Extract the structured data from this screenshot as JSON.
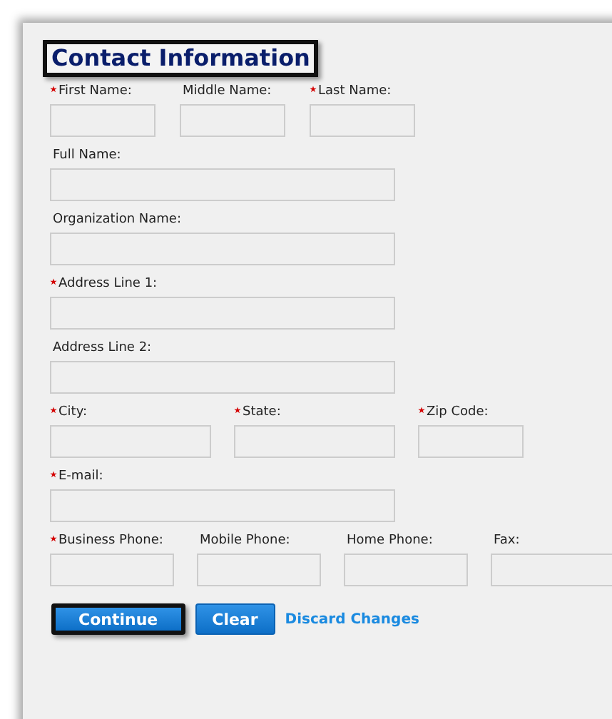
{
  "title": "Contact Information",
  "rows": [
    {
      "fields": [
        {
          "label": "First Name:",
          "required": true
        },
        {
          "label": "Middle Name:",
          "required": false
        },
        {
          "label": "Last Name:",
          "required": true
        }
      ]
    },
    {
      "fields": [
        {
          "label": "Full Name:",
          "required": false
        }
      ]
    },
    {
      "fields": [
        {
          "label": "Organization Name:",
          "required": false
        }
      ]
    },
    {
      "fields": [
        {
          "label": "Address Line 1:",
          "required": true
        }
      ]
    },
    {
      "fields": [
        {
          "label": "Address Line 2:",
          "required": false
        }
      ]
    },
    {
      "fields": [
        {
          "label": "City:",
          "required": true
        },
        {
          "label": "State:",
          "required": true
        },
        {
          "label": "Zip Code:",
          "required": true
        }
      ]
    },
    {
      "fields": [
        {
          "label": "E-mail:",
          "required": true
        }
      ]
    },
    {
      "fields": [
        {
          "label": "Business Phone:",
          "required": true
        },
        {
          "label": "Mobile Phone:",
          "required": false
        },
        {
          "label": "Home Phone:",
          "required": false
        },
        {
          "label": "Fax:",
          "required": false
        }
      ]
    }
  ],
  "buttons": [
    {
      "label": "Continue",
      "focused": true
    },
    {
      "label": "Clear",
      "focused": false
    }
  ],
  "link": "Discard Changes"
}
